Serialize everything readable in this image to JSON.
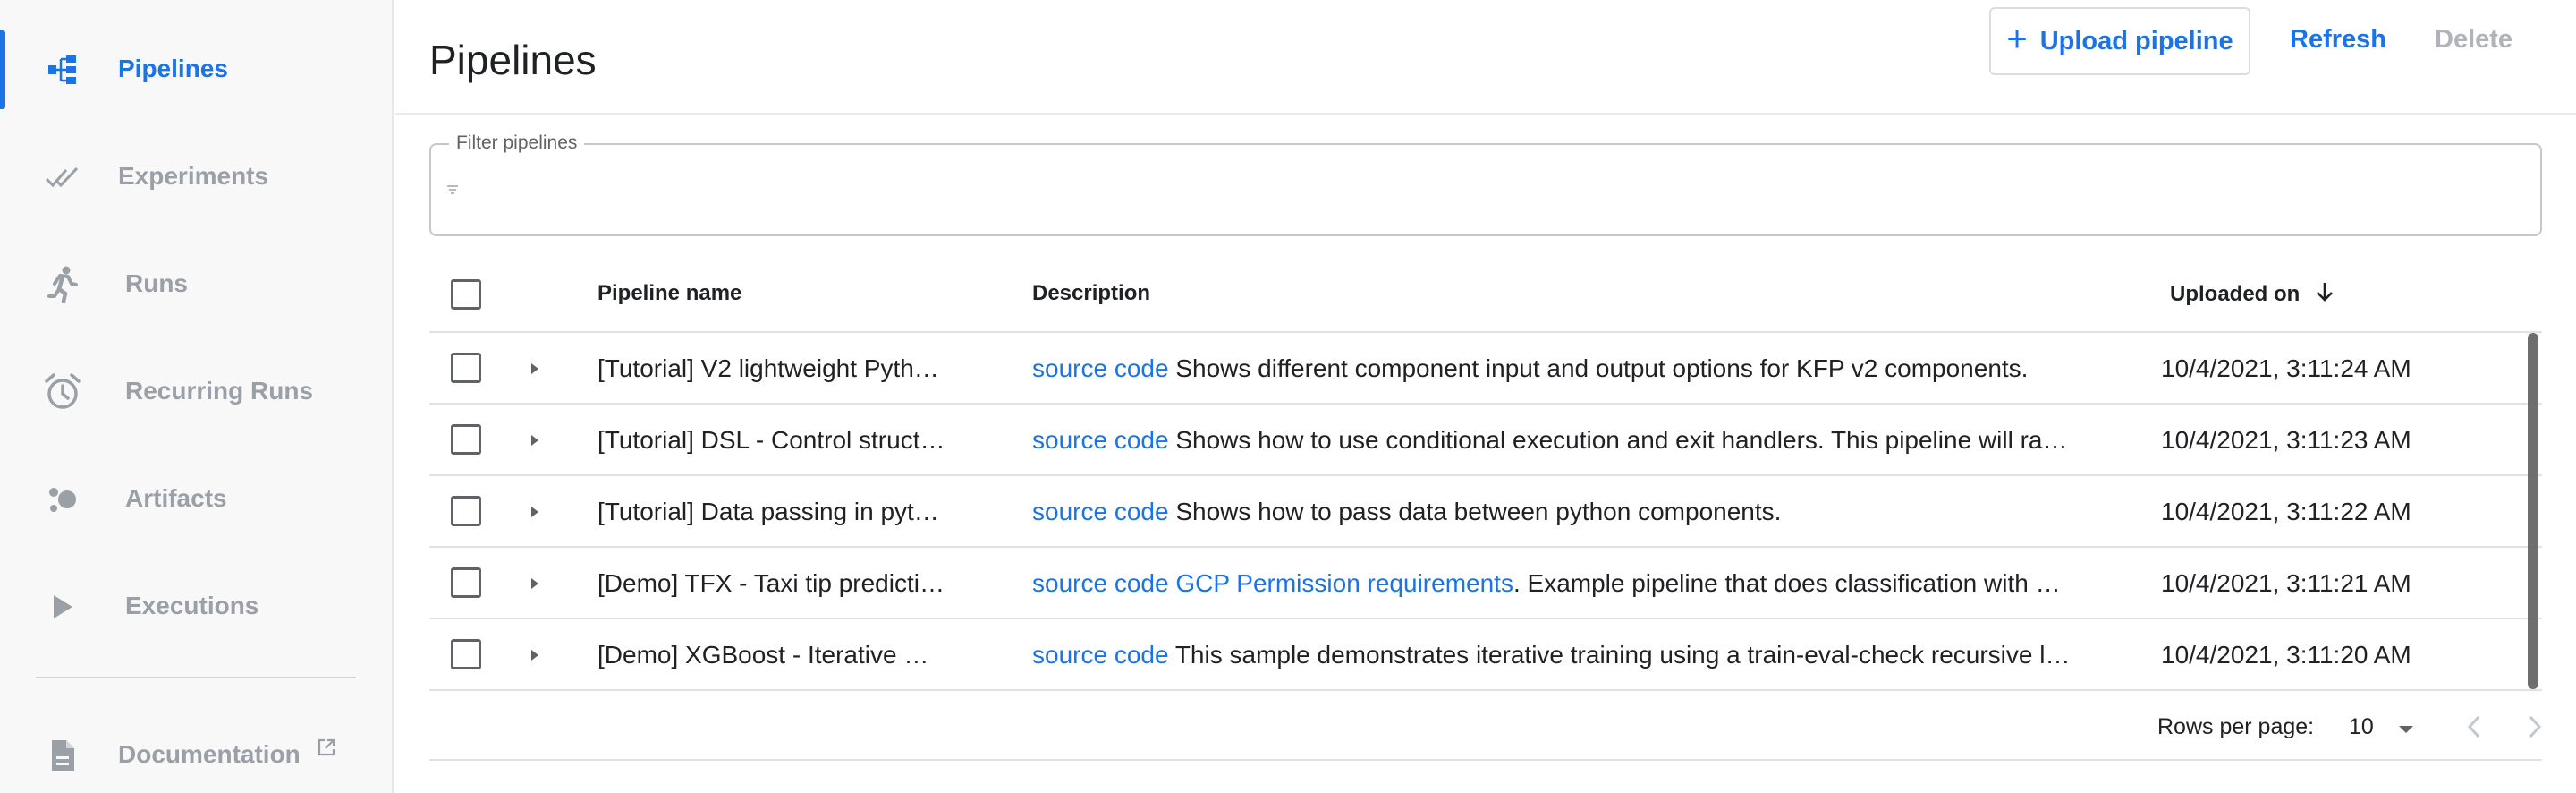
{
  "sidebar": {
    "items": [
      {
        "label": "Pipelines",
        "icon": "pipelines-icon",
        "active": true
      },
      {
        "label": "Experiments",
        "icon": "experiments-icon"
      },
      {
        "label": "Runs",
        "icon": "runs-icon"
      },
      {
        "label": "Recurring Runs",
        "icon": "alarm-clock-icon"
      },
      {
        "label": "Artifacts",
        "icon": "artifacts-icon"
      },
      {
        "label": "Executions",
        "icon": "play-icon"
      }
    ],
    "documentation": {
      "label": "Documentation",
      "icon": "document-icon",
      "external_icon": "external-link-icon"
    }
  },
  "header": {
    "title": "Pipelines",
    "upload_label": "Upload pipeline",
    "refresh_label": "Refresh",
    "delete_label": "Delete"
  },
  "filter": {
    "label": "Filter pipelines",
    "value": "",
    "icon": "filter-icon"
  },
  "table": {
    "columns": {
      "name": "Pipeline name",
      "description": "Description",
      "uploaded": "Uploaded on"
    },
    "rows": [
      {
        "name": "[Tutorial] V2 lightweight Pyth…",
        "links": [
          "source code"
        ],
        "description": " Shows different component input and output options for KFP v2 components.",
        "uploaded": "10/4/2021, 3:11:24 AM"
      },
      {
        "name": "[Tutorial] DSL - Control struct…",
        "links": [
          "source code"
        ],
        "description": " Shows how to use conditional execution and exit handlers. This pipeline will ra…",
        "uploaded": "10/4/2021, 3:11:23 AM"
      },
      {
        "name": "[Tutorial] Data passing in pyt…",
        "links": [
          "source code"
        ],
        "description": " Shows how to pass data between python components.",
        "uploaded": "10/4/2021, 3:11:22 AM"
      },
      {
        "name": "[Demo] TFX - Taxi tip predicti…",
        "links": [
          "source code",
          "GCP Permission requirements"
        ],
        "description": ". Example pipeline that does classification with …",
        "uploaded": "10/4/2021, 3:11:21 AM"
      },
      {
        "name": "[Demo] XGBoost - Iterative …",
        "links": [
          "source code"
        ],
        "description": " This sample demonstrates iterative training using a train-eval-check recursive l…",
        "uploaded": "10/4/2021, 3:11:20 AM"
      }
    ]
  },
  "pagination": {
    "rows_per_page_label": "Rows per page:",
    "rows_per_page": "10"
  },
  "colors": {
    "accent": "#1a73e8",
    "muted": "#9aa0a6",
    "disabled": "#b0b4b9"
  }
}
